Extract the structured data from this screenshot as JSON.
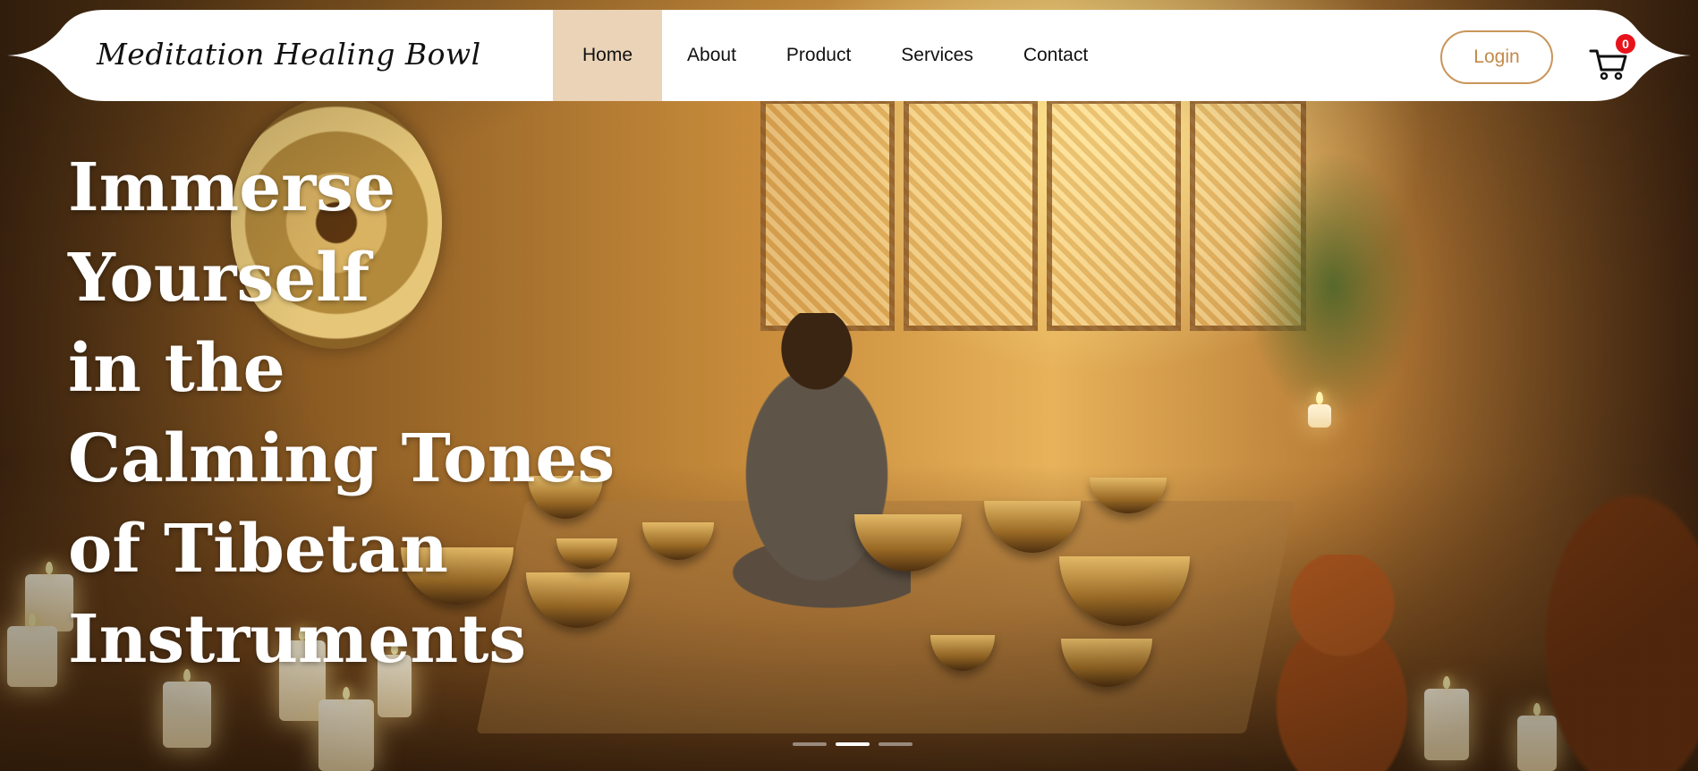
{
  "brand": {
    "name": "Meditation Healing Bowl"
  },
  "nav": {
    "items": [
      {
        "label": "Home",
        "active": true
      },
      {
        "label": "About",
        "active": false
      },
      {
        "label": "Product",
        "active": false
      },
      {
        "label": "Services",
        "active": false
      },
      {
        "label": "Contact",
        "active": false
      }
    ]
  },
  "header": {
    "login_label": "Login",
    "cart_icon": "cart-icon",
    "cart_count": "0"
  },
  "hero": {
    "headline_lines": [
      "Immerse",
      "Yourself",
      "in the",
      "Calming Tones",
      "of Tibetan",
      "Instruments"
    ],
    "slides": {
      "count": 3,
      "active_index": 1
    }
  },
  "colors": {
    "accent": "#c9965a",
    "active_nav_bg": "#ead3b7",
    "badge": "#e8121b"
  }
}
